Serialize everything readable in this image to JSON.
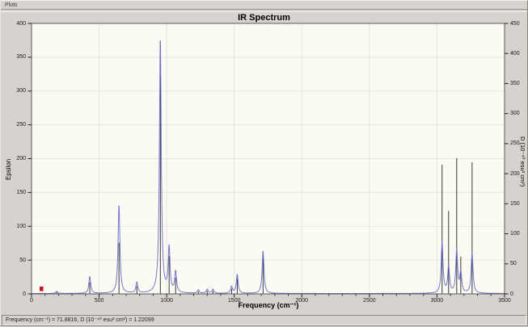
{
  "window": {
    "top_label": "Plots"
  },
  "chart_data": {
    "type": "line",
    "title": "IR Spectrum",
    "xlabel": "Frequency (cm⁻¹)",
    "ylabel_left": "Epsilon",
    "ylabel_right": "D (10⁻⁴⁰ esu² cm²)",
    "xlim": [
      0,
      3500
    ],
    "ylim_left": [
      0,
      400
    ],
    "ylim_right": [
      0,
      450
    ],
    "x_ticks": [
      0,
      500,
      1000,
      1500,
      2000,
      2500,
      3000,
      3500
    ],
    "x_minor_step": 100,
    "left_ticks": [
      0,
      50,
      100,
      150,
      200,
      250,
      300,
      350,
      400
    ],
    "right_ticks": [
      0,
      50,
      100,
      150,
      200,
      250,
      300,
      350,
      400,
      450
    ],
    "grid": true,
    "legend": "none",
    "plot_bg": "#fbfbf3",
    "grid_color": "#e7e7df",
    "frame_color": "#5a5a5a",
    "curve_color": "#7474ce",
    "stick_color": "#222222",
    "marker_color": "#cc1111",
    "lorentzian_halfwidth": 8,
    "peaks": [
      {
        "freq": 186,
        "epsilon": 3,
        "intensity": 3
      },
      {
        "freq": 431,
        "epsilon": 25,
        "intensity": 19
      },
      {
        "freq": 647,
        "epsilon": 131,
        "intensity": 85
      },
      {
        "freq": 779,
        "epsilon": 16,
        "intensity": 13
      },
      {
        "freq": 953,
        "epsilon": 378,
        "intensity": 364
      },
      {
        "freq": 1018,
        "epsilon": 66,
        "intensity": 63
      },
      {
        "freq": 1066,
        "epsilon": 31,
        "intensity": 27
      },
      {
        "freq": 1234,
        "epsilon": 5,
        "intensity": 4
      },
      {
        "freq": 1300,
        "epsilon": 6,
        "intensity": 5
      },
      {
        "freq": 1342,
        "epsilon": 6,
        "intensity": 5
      },
      {
        "freq": 1480,
        "epsilon": 10,
        "intensity": 9
      },
      {
        "freq": 1522,
        "epsilon": 28,
        "intensity": 26
      },
      {
        "freq": 1713,
        "epsilon": 63,
        "intensity": 70
      },
      {
        "freq": 3038,
        "epsilon": 75,
        "intensity": 215
      },
      {
        "freq": 3086,
        "epsilon": 39,
        "intensity": 138
      },
      {
        "freq": 3146,
        "epsilon": 63,
        "intensity": 226
      },
      {
        "freq": 3176,
        "epsilon": 30,
        "intensity": 62
      },
      {
        "freq": 3260,
        "epsilon": 60,
        "intensity": 219
      }
    ],
    "cursor": {
      "freq": 71.8816,
      "intensity": 1.22099
    }
  },
  "status_bar": {
    "text": "Frequency (cm⁻¹) = 71.8816, D (10⁻⁴⁰ esu² cm²) = 1.22099"
  }
}
